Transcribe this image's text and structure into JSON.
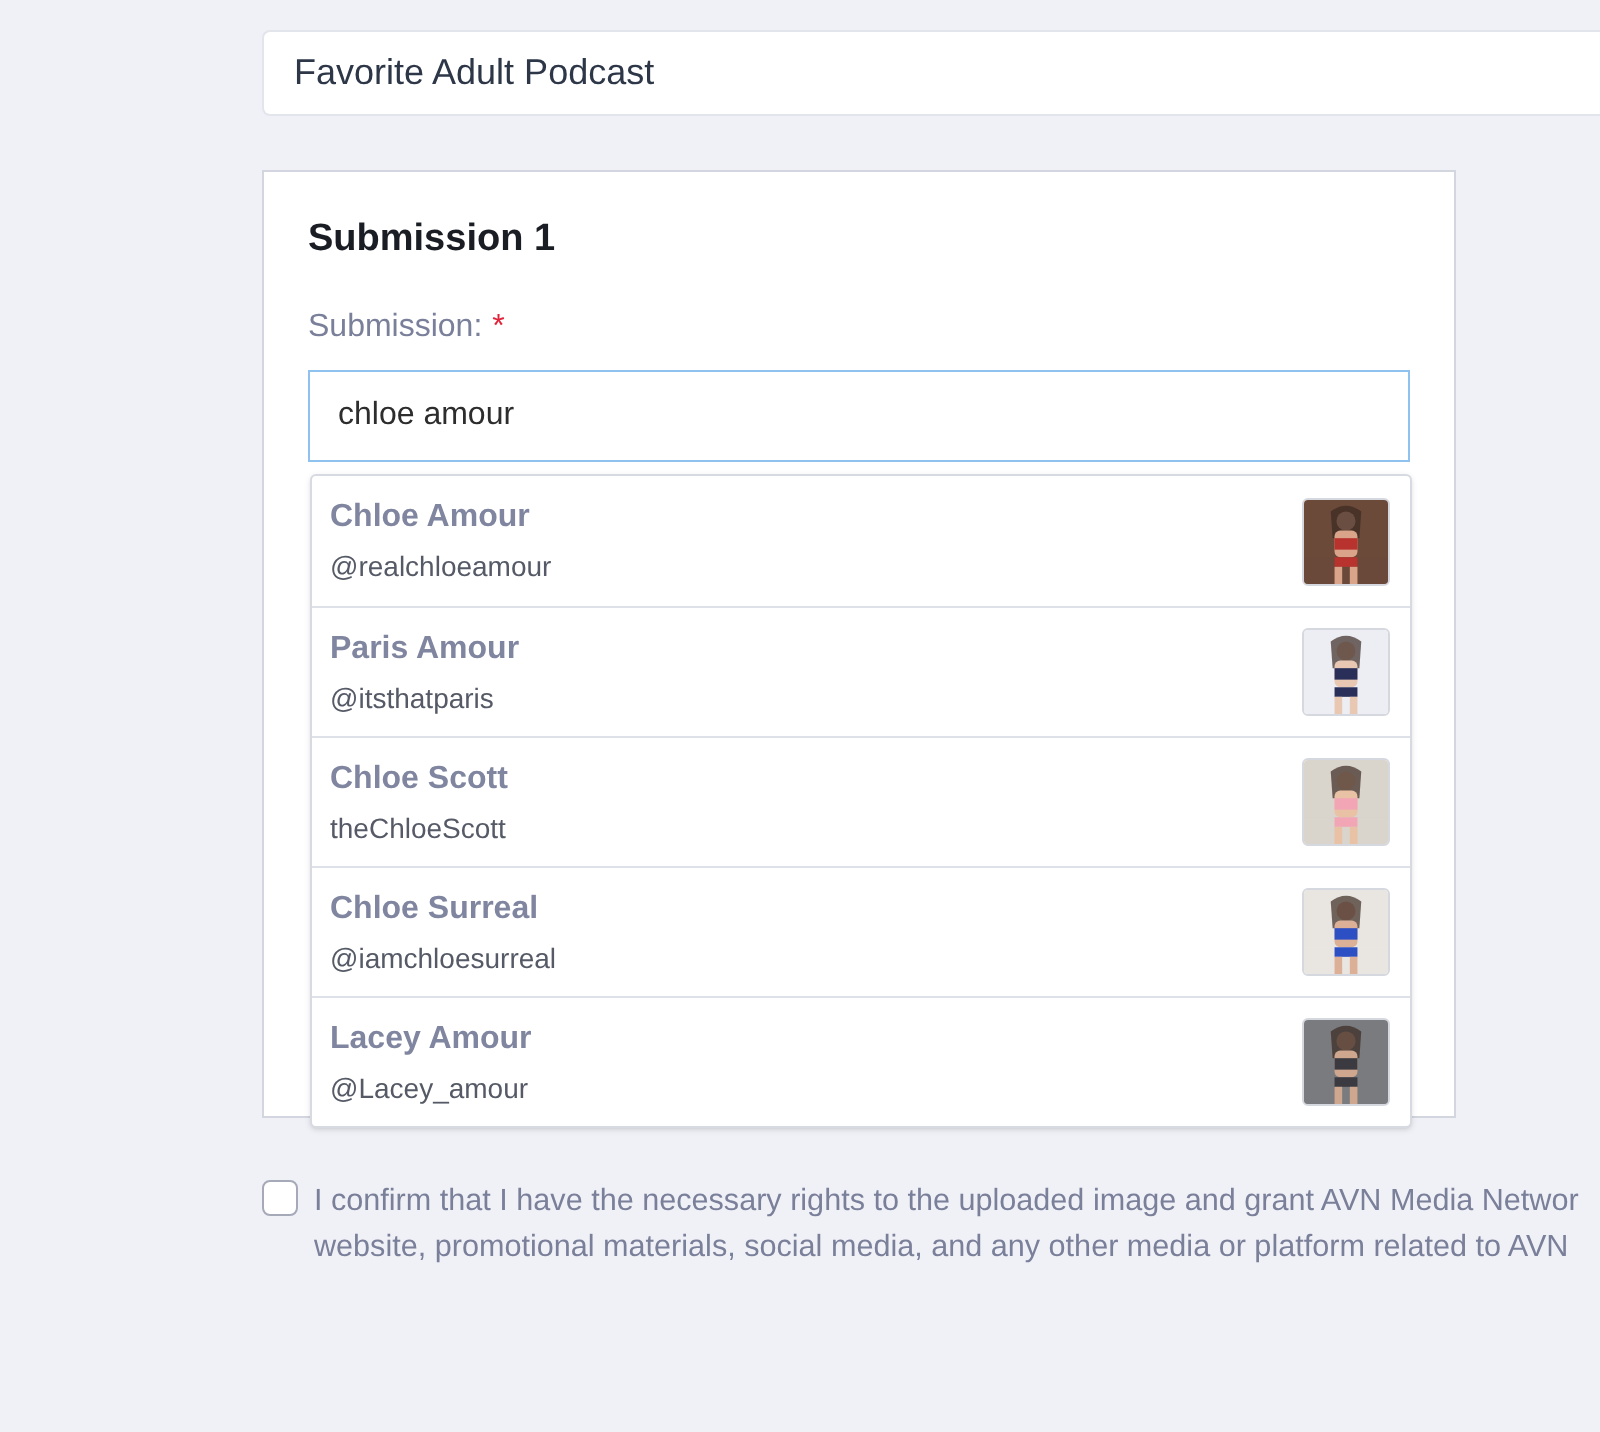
{
  "category_field": {
    "value": "Favorite Adult Podcast"
  },
  "submission_card": {
    "title": "Submission 1",
    "label": "Submission:",
    "required_mark": "*",
    "input": {
      "value": "chloe amour"
    },
    "suggestions": [
      {
        "name": "Chloe Amour",
        "handle": "@realchloeamour"
      },
      {
        "name": "Paris Amour",
        "handle": "@itsthatparis"
      },
      {
        "name": "Chloe Scott",
        "handle": "theChloeScott"
      },
      {
        "name": "Chloe Surreal",
        "handle": "@iamchloesurreal"
      },
      {
        "name": "Lacey Amour",
        "handle": "@Lacey_amour"
      }
    ]
  },
  "consent": {
    "checked": false,
    "lines": [
      "I confirm that I have the necessary rights to the uploaded image and grant AVN Media Networ",
      "website, promotional materials, social media, and any other media or platform related to AVN"
    ]
  }
}
